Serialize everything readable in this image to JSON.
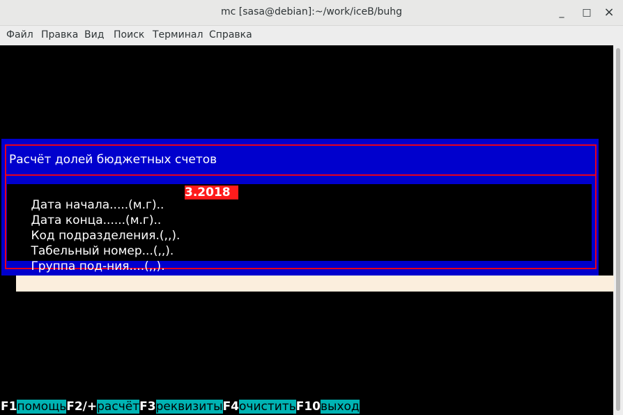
{
  "window": {
    "title": "mc [sasa@debian]:~/work/iceB/buhg",
    "minimize_icon": "_",
    "maximize_icon": "□",
    "close_icon": "×"
  },
  "menu": [
    "Файл",
    "Правка",
    "Вид",
    "Поиск",
    "Терминал",
    "Справка"
  ],
  "dialog": {
    "title": "Расчёт долей бюджетных счетов",
    "fields": [
      {
        "label": "Дата начала.....(м.г)..",
        "value": "3.2018"
      },
      {
        "label": "Дата конца......(м.г)..",
        "value": ""
      },
      {
        "label": "Код подразделения.(,,).",
        "value": ""
      },
      {
        "label": "Табельный номер...(,,).",
        "value": ""
      },
      {
        "label": "Группа под-ния....(,,).",
        "value": ""
      }
    ]
  },
  "fkeys": [
    {
      "key": "F1",
      "label": "помощь"
    },
    {
      "key": "F2/+",
      "label": "расчёт"
    },
    {
      "key": "F3",
      "label": "реквизиты"
    },
    {
      "key": "F4",
      "label": "очистить"
    },
    {
      "key": "F10",
      "label": "выход"
    }
  ],
  "colors": {
    "dialog_bg": "#0000cd",
    "frame": "#e8001c",
    "active_field": "#ff1c1c",
    "fkey_label_bg": "#00b3b3"
  }
}
